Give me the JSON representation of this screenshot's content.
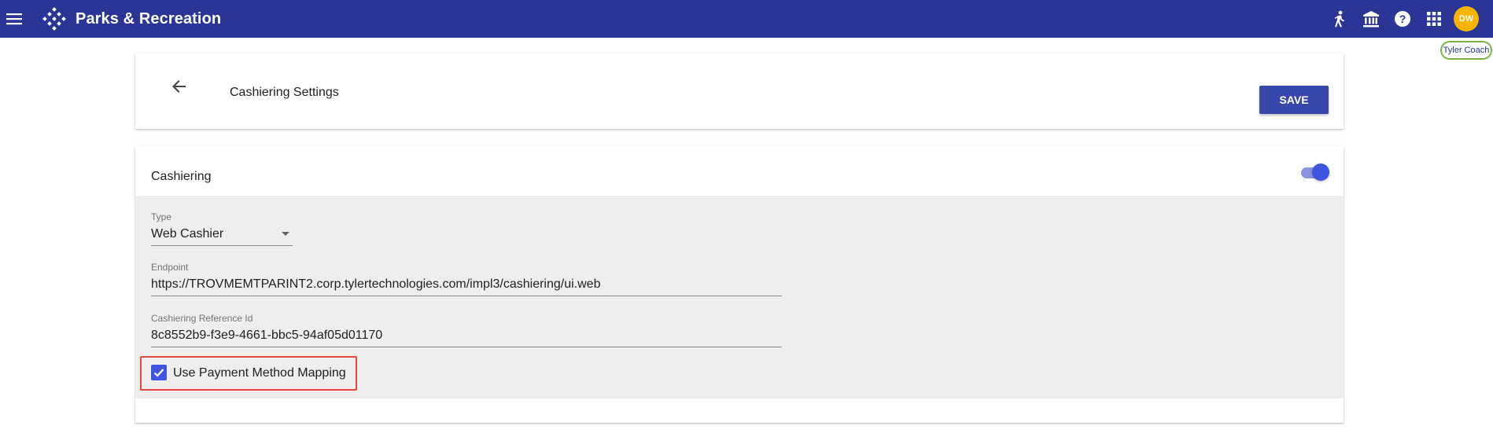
{
  "app": {
    "title": "Parks & Recreation",
    "avatar_initials": "DW",
    "coach_label": "Tyler Coach",
    "icons": [
      "menu-icon",
      "logo-icon",
      "walking-person-icon",
      "bank-icon",
      "help-icon",
      "apps-grid-icon"
    ]
  },
  "header": {
    "title": "Cashiering Settings",
    "save_label": "SAVE"
  },
  "cashiering": {
    "section_title": "Cashiering",
    "enabled": true,
    "type": {
      "label": "Type",
      "value": "Web Cashier"
    },
    "endpoint": {
      "label": "Endpoint",
      "value": "https://TROVMEMTPARINT2.corp.tylertechnologies.com/impl3/cashiering/ui.web"
    },
    "reference_id": {
      "label": "Cashiering Reference Id",
      "value": "8c8552b9-f3e9-4661-bbc5-94af05d01170"
    },
    "payment_mapping": {
      "label": "Use Payment Method Mapping",
      "checked": true
    }
  },
  "colors": {
    "appbar": "#2b3595",
    "primary": "#3948ac",
    "toggle": "#3d55e0",
    "avatar": "#f9b400",
    "highlight": "#e8453c"
  }
}
